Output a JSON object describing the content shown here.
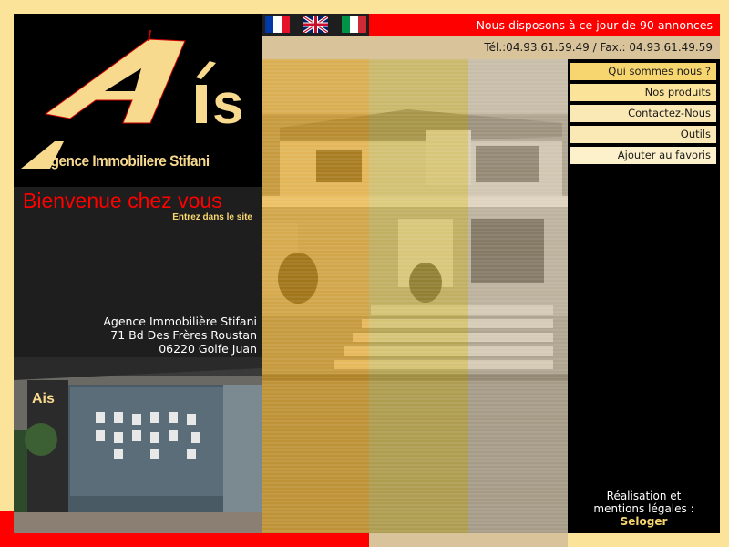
{
  "logo": {
    "letters": "is",
    "brand_name": "Agence Immobiliere Stifani"
  },
  "welcome": {
    "title": "Bienvenue chez vous",
    "enter_link": "Entrez dans le site"
  },
  "address": {
    "line1": "Agence Immobilière Stifani",
    "line2": "71 Bd Des Frères Roustan",
    "line3": "06220 Golfe Juan"
  },
  "flags": [
    {
      "icon": "flag-france-icon"
    },
    {
      "icon": "flag-uk-icon"
    },
    {
      "icon": "flag-italy-icon"
    }
  ],
  "announcement": "Nous disposons à ce jour de 90 annonces",
  "contact": "Tél.:04.93.61.59.49 / Fax.: 04.93.61.49.59",
  "nav": {
    "items": [
      {
        "label": "Qui sommes nous ?"
      },
      {
        "label": "Nos produits"
      },
      {
        "label": "Contactez-Nous"
      },
      {
        "label": "Outils"
      },
      {
        "label": "Ajouter au favoris"
      }
    ]
  },
  "credits": {
    "line1": "Réalisation et",
    "line2": "mentions légales :",
    "link": "Seloger"
  },
  "colors": {
    "red": "#ff0000",
    "gold": "#f8d66f",
    "cream": "#fbe39a",
    "black": "#000000"
  }
}
